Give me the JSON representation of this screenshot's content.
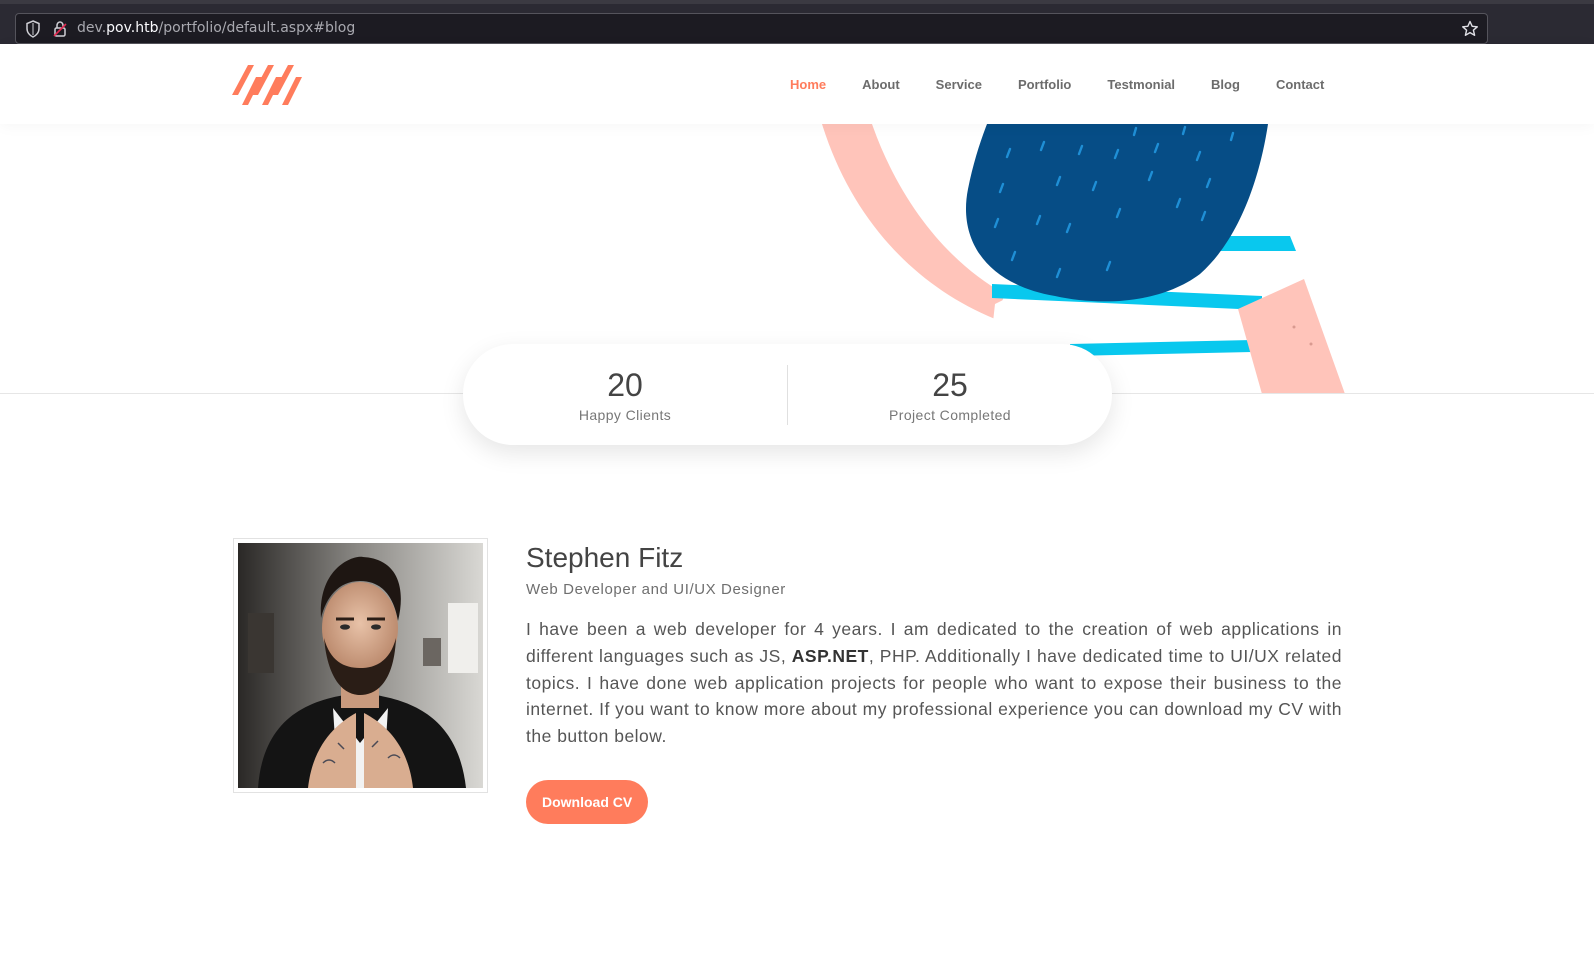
{
  "browser": {
    "url_prefix": "dev.",
    "url_host": "pov.htb",
    "url_path": "/portfolio/default.aspx#blog"
  },
  "colors": {
    "accent": "#ff7c5c",
    "navy": "#064d86",
    "cyan": "#09c8ee",
    "pink": "#ffc4ba"
  },
  "nav": {
    "items": [
      {
        "label": "Home",
        "active": true
      },
      {
        "label": "About"
      },
      {
        "label": "Service"
      },
      {
        "label": "Portfolio"
      },
      {
        "label": "Testmonial"
      },
      {
        "label": "Blog"
      },
      {
        "label": "Contact"
      }
    ]
  },
  "stats": [
    {
      "number": "20",
      "label": "Happy Clients"
    },
    {
      "number": "25",
      "label": "Project Completed"
    }
  ],
  "profile": {
    "name": "Stephen Fitz",
    "role": "Web Developer and UI/UX Designer",
    "bio_before": "I have been a web developer for 4 years. I am dedicated to the creation of web applications in different languages such as JS, ",
    "bio_bold": "ASP.NET",
    "bio_after": ", PHP. Additionally I have dedicated time to UI/UX related topics. I have done web application projects for people who want to expose their business to the internet. If you want to know more about my professional experience you can download my CV with the button below.",
    "button_label": "Download CV"
  }
}
